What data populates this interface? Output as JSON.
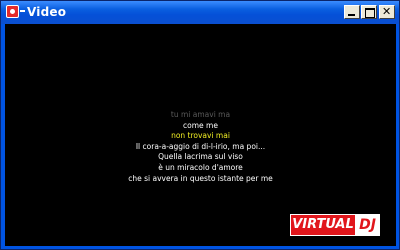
{
  "window": {
    "title": "Video",
    "buttons": {
      "minimize": "minimize",
      "maximize": "maximize",
      "close": "✕"
    }
  },
  "lyrics": [
    {
      "text": "tu mi amavi ma",
      "style": "previous"
    },
    {
      "text": "come me",
      "style": "normal"
    },
    {
      "text": "non trovavi mai",
      "style": "current"
    },
    {
      "text": "Il cora-a-aggio di di-l-irio, ma poi...",
      "style": "normal"
    },
    {
      "text": "Quella lacrima sul viso",
      "style": "normal"
    },
    {
      "text": "è un miracolo d'amore",
      "style": "normal"
    },
    {
      "text": "che si avvera in questo istante per me",
      "style": "normal"
    }
  ],
  "logo": {
    "part1": "VIRTUAL",
    "part2": "DJ"
  },
  "colors": {
    "current_line": "#f2ef24",
    "normal_line": "#ffffff",
    "previous_line": "#5a5a5a",
    "logo_red": "#e1161c"
  }
}
